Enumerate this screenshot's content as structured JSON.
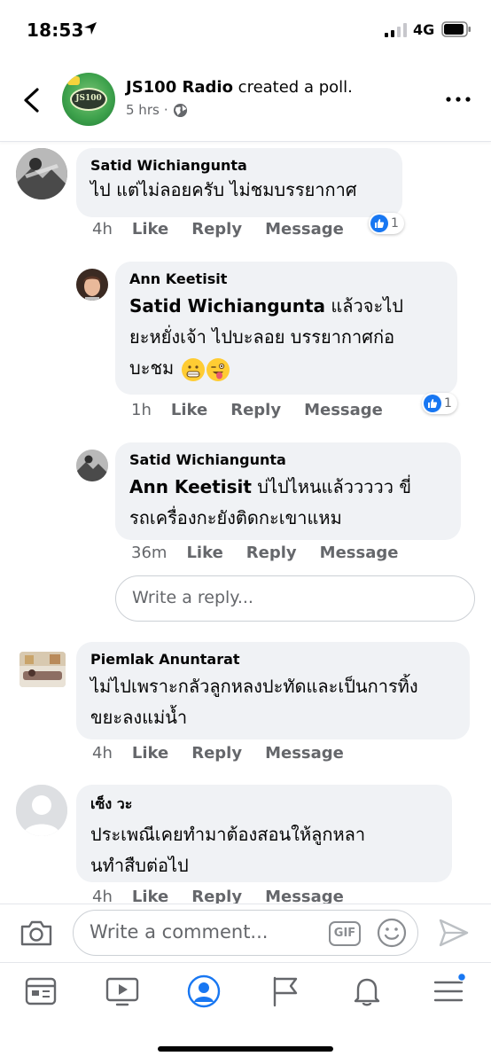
{
  "status_bar": {
    "time": "18:53",
    "network": "4G"
  },
  "post": {
    "page_name": "JS100 Radio",
    "action": "created a poll.",
    "logo_text": "JS100",
    "time_ago": "5 hrs",
    "separator": "·"
  },
  "comments": [
    {
      "author": "Satid Wichiangunta",
      "text": "ไป แต่ไม่ลอยครับ ไม่ชมบรรยากาศ",
      "age": "4h",
      "like": "Like",
      "reply": "Reply",
      "message": "Message",
      "reaction_count": "1",
      "replies": [
        {
          "author": "Ann Keetisit",
          "mention": "Satid Wichiangunta",
          "text_line1": " แล้วจะไป",
          "text_line2": "ยะหยั่งเจ้า ไปบะลอย บรรยากาศก่อ",
          "text_line3": "บะชม",
          "age": "1h",
          "like": "Like",
          "reply": "Reply",
          "message": "Message",
          "reaction_count": "1"
        },
        {
          "author": "Satid Wichiangunta",
          "mention": "Ann Keetisit",
          "text_line1": " บ่ไปไหนแล้ววววว ขี่",
          "text_line2": "รถเครื่องกะยังติดกะเขาแหม",
          "age": "36m",
          "like": "Like",
          "reply": "Reply",
          "message": "Message"
        }
      ],
      "reply_placeholder": "Write a reply..."
    },
    {
      "author": "Piemlak Anuntarat",
      "text_line1": "ไม่ไปเพราะกลัวลูกหลงปะทัดและเป็นการทิ้ง",
      "text_line2": "ขยะลงแม่น้ำ",
      "age": "4h",
      "like": "Like",
      "reply": "Reply",
      "message": "Message"
    },
    {
      "author": "เซ็ง วะ",
      "text_line1": "ประเพณีเคยทำมาต้องสอนให้ลูกหลา",
      "text_line2": "นทำสืบต่อไป",
      "age": "4h",
      "like": "Like",
      "reply": "Reply",
      "message": "Message"
    }
  ],
  "composer": {
    "placeholder": "Write a comment...",
    "gif_label": "GIF"
  },
  "colors": {
    "accent": "#1877f2",
    "bubble": "#f0f2f5",
    "muted": "#65676b"
  },
  "tabs": [
    "news-feed",
    "watch",
    "profile",
    "pages",
    "notifications",
    "menu"
  ]
}
